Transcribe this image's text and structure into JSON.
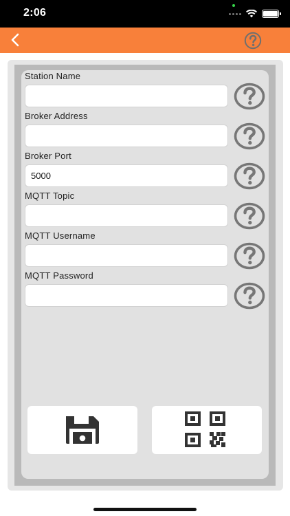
{
  "status_bar": {
    "time": "2:06"
  },
  "icons": {
    "back": "chevron-left-icon",
    "help": "question-circle-icon",
    "save": "floppy-disk-icon",
    "qr": "qr-code-icon"
  },
  "colors": {
    "accent": "#f8803a",
    "panel": "#e1e1e1",
    "help_icon": "#777777"
  },
  "form": {
    "fields": [
      {
        "label": "Station Name",
        "value": ""
      },
      {
        "label": "Broker Address",
        "value": ""
      },
      {
        "label": "Broker Port",
        "value": "5000"
      },
      {
        "label": "MQTT Topic",
        "value": ""
      },
      {
        "label": "MQTT Username",
        "value": ""
      },
      {
        "label": "MQTT Password",
        "value": ""
      }
    ]
  }
}
